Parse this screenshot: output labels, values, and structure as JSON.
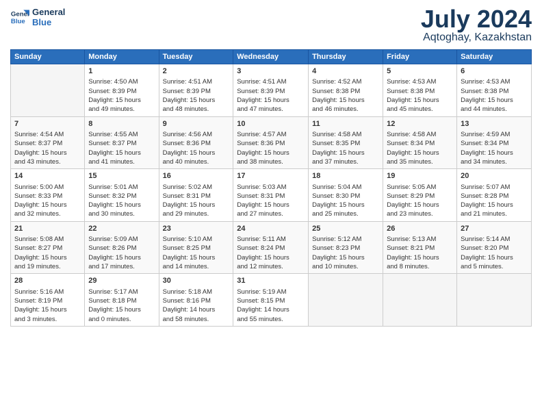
{
  "logo": {
    "line1": "General",
    "line2": "Blue"
  },
  "title": "July 2024",
  "location": "Aqtoghay, Kazakhstan",
  "weekdays": [
    "Sunday",
    "Monday",
    "Tuesday",
    "Wednesday",
    "Thursday",
    "Friday",
    "Saturday"
  ],
  "weeks": [
    [
      {
        "day": "",
        "info": ""
      },
      {
        "day": "1",
        "info": "Sunrise: 4:50 AM\nSunset: 8:39 PM\nDaylight: 15 hours\nand 49 minutes."
      },
      {
        "day": "2",
        "info": "Sunrise: 4:51 AM\nSunset: 8:39 PM\nDaylight: 15 hours\nand 48 minutes."
      },
      {
        "day": "3",
        "info": "Sunrise: 4:51 AM\nSunset: 8:39 PM\nDaylight: 15 hours\nand 47 minutes."
      },
      {
        "day": "4",
        "info": "Sunrise: 4:52 AM\nSunset: 8:38 PM\nDaylight: 15 hours\nand 46 minutes."
      },
      {
        "day": "5",
        "info": "Sunrise: 4:53 AM\nSunset: 8:38 PM\nDaylight: 15 hours\nand 45 minutes."
      },
      {
        "day": "6",
        "info": "Sunrise: 4:53 AM\nSunset: 8:38 PM\nDaylight: 15 hours\nand 44 minutes."
      }
    ],
    [
      {
        "day": "7",
        "info": "Sunrise: 4:54 AM\nSunset: 8:37 PM\nDaylight: 15 hours\nand 43 minutes."
      },
      {
        "day": "8",
        "info": "Sunrise: 4:55 AM\nSunset: 8:37 PM\nDaylight: 15 hours\nand 41 minutes."
      },
      {
        "day": "9",
        "info": "Sunrise: 4:56 AM\nSunset: 8:36 PM\nDaylight: 15 hours\nand 40 minutes."
      },
      {
        "day": "10",
        "info": "Sunrise: 4:57 AM\nSunset: 8:36 PM\nDaylight: 15 hours\nand 38 minutes."
      },
      {
        "day": "11",
        "info": "Sunrise: 4:58 AM\nSunset: 8:35 PM\nDaylight: 15 hours\nand 37 minutes."
      },
      {
        "day": "12",
        "info": "Sunrise: 4:58 AM\nSunset: 8:34 PM\nDaylight: 15 hours\nand 35 minutes."
      },
      {
        "day": "13",
        "info": "Sunrise: 4:59 AM\nSunset: 8:34 PM\nDaylight: 15 hours\nand 34 minutes."
      }
    ],
    [
      {
        "day": "14",
        "info": "Sunrise: 5:00 AM\nSunset: 8:33 PM\nDaylight: 15 hours\nand 32 minutes."
      },
      {
        "day": "15",
        "info": "Sunrise: 5:01 AM\nSunset: 8:32 PM\nDaylight: 15 hours\nand 30 minutes."
      },
      {
        "day": "16",
        "info": "Sunrise: 5:02 AM\nSunset: 8:31 PM\nDaylight: 15 hours\nand 29 minutes."
      },
      {
        "day": "17",
        "info": "Sunrise: 5:03 AM\nSunset: 8:31 PM\nDaylight: 15 hours\nand 27 minutes."
      },
      {
        "day": "18",
        "info": "Sunrise: 5:04 AM\nSunset: 8:30 PM\nDaylight: 15 hours\nand 25 minutes."
      },
      {
        "day": "19",
        "info": "Sunrise: 5:05 AM\nSunset: 8:29 PM\nDaylight: 15 hours\nand 23 minutes."
      },
      {
        "day": "20",
        "info": "Sunrise: 5:07 AM\nSunset: 8:28 PM\nDaylight: 15 hours\nand 21 minutes."
      }
    ],
    [
      {
        "day": "21",
        "info": "Sunrise: 5:08 AM\nSunset: 8:27 PM\nDaylight: 15 hours\nand 19 minutes."
      },
      {
        "day": "22",
        "info": "Sunrise: 5:09 AM\nSunset: 8:26 PM\nDaylight: 15 hours\nand 17 minutes."
      },
      {
        "day": "23",
        "info": "Sunrise: 5:10 AM\nSunset: 8:25 PM\nDaylight: 15 hours\nand 14 minutes."
      },
      {
        "day": "24",
        "info": "Sunrise: 5:11 AM\nSunset: 8:24 PM\nDaylight: 15 hours\nand 12 minutes."
      },
      {
        "day": "25",
        "info": "Sunrise: 5:12 AM\nSunset: 8:23 PM\nDaylight: 15 hours\nand 10 minutes."
      },
      {
        "day": "26",
        "info": "Sunrise: 5:13 AM\nSunset: 8:21 PM\nDaylight: 15 hours\nand 8 minutes."
      },
      {
        "day": "27",
        "info": "Sunrise: 5:14 AM\nSunset: 8:20 PM\nDaylight: 15 hours\nand 5 minutes."
      }
    ],
    [
      {
        "day": "28",
        "info": "Sunrise: 5:16 AM\nSunset: 8:19 PM\nDaylight: 15 hours\nand 3 minutes."
      },
      {
        "day": "29",
        "info": "Sunrise: 5:17 AM\nSunset: 8:18 PM\nDaylight: 15 hours\nand 0 minutes."
      },
      {
        "day": "30",
        "info": "Sunrise: 5:18 AM\nSunset: 8:16 PM\nDaylight: 14 hours\nand 58 minutes."
      },
      {
        "day": "31",
        "info": "Sunrise: 5:19 AM\nSunset: 8:15 PM\nDaylight: 14 hours\nand 55 minutes."
      },
      {
        "day": "",
        "info": ""
      },
      {
        "day": "",
        "info": ""
      },
      {
        "day": "",
        "info": ""
      }
    ]
  ]
}
